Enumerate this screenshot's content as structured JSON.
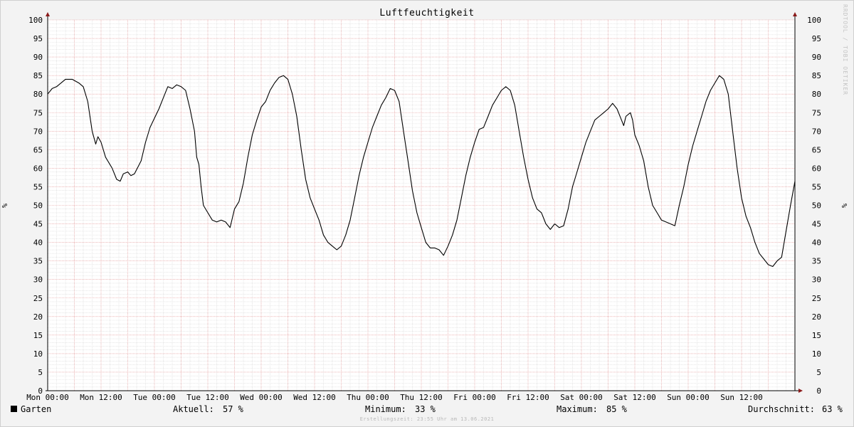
{
  "chart_data": {
    "type": "line",
    "title": "Luftfeuchtigkeit",
    "ylabel": "%",
    "ylabel_right": "%",
    "ylim": [
      0,
      100
    ],
    "yticks": [
      0,
      5,
      10,
      15,
      20,
      25,
      30,
      35,
      40,
      45,
      50,
      55,
      60,
      65,
      70,
      75,
      80,
      85,
      90,
      95,
      100
    ],
    "xlim_hours": [
      0,
      168
    ],
    "xticks": [
      {
        "h": 0,
        "label": "Mon 00:00"
      },
      {
        "h": 12,
        "label": "Mon 12:00"
      },
      {
        "h": 24,
        "label": "Tue 00:00"
      },
      {
        "h": 36,
        "label": "Tue 12:00"
      },
      {
        "h": 48,
        "label": "Wed 00:00"
      },
      {
        "h": 60,
        "label": "Wed 12:00"
      },
      {
        "h": 72,
        "label": "Thu 00:00"
      },
      {
        "h": 84,
        "label": "Thu 12:00"
      },
      {
        "h": 96,
        "label": "Fri 00:00"
      },
      {
        "h": 108,
        "label": "Fri 12:00"
      },
      {
        "h": 120,
        "label": "Sat 00:00"
      },
      {
        "h": 132,
        "label": "Sat 12:00"
      },
      {
        "h": 144,
        "label": "Sun 00:00"
      },
      {
        "h": 156,
        "label": "Sun 12:00"
      }
    ],
    "grid": true,
    "series": [
      {
        "name": "Garten",
        "color": "#000000",
        "points": [
          [
            0,
            80
          ],
          [
            1,
            81.5
          ],
          [
            2,
            82
          ],
          [
            3,
            83
          ],
          [
            4,
            84
          ],
          [
            5.5,
            84
          ],
          [
            7,
            83
          ],
          [
            8,
            82
          ],
          [
            9,
            78
          ],
          [
            10,
            70
          ],
          [
            10.8,
            66.5
          ],
          [
            11.3,
            68.5
          ],
          [
            12,
            67
          ],
          [
            13,
            63
          ],
          [
            14.5,
            60
          ],
          [
            15.5,
            57
          ],
          [
            16.3,
            56.5
          ],
          [
            17,
            58.5
          ],
          [
            18,
            59
          ],
          [
            18.7,
            58
          ],
          [
            19.5,
            58.5
          ],
          [
            21,
            62
          ],
          [
            22,
            67
          ],
          [
            23,
            71
          ],
          [
            24,
            73.5
          ],
          [
            25,
            76
          ],
          [
            26,
            79
          ],
          [
            27,
            82
          ],
          [
            28,
            81.5
          ],
          [
            29,
            82.5
          ],
          [
            30,
            82
          ],
          [
            31,
            81
          ],
          [
            32,
            76
          ],
          [
            33,
            70
          ],
          [
            33.5,
            63
          ],
          [
            34,
            61
          ],
          [
            34.5,
            55
          ],
          [
            35,
            50
          ],
          [
            36,
            48
          ],
          [
            37,
            46
          ],
          [
            38,
            45.5
          ],
          [
            39,
            46
          ],
          [
            40,
            45.5
          ],
          [
            41,
            44
          ],
          [
            42,
            49
          ],
          [
            43,
            51
          ],
          [
            44,
            56
          ],
          [
            45,
            63
          ],
          [
            46,
            69
          ],
          [
            47,
            73
          ],
          [
            48,
            76.5
          ],
          [
            49,
            78
          ],
          [
            50,
            81
          ],
          [
            51,
            83
          ],
          [
            52,
            84.5
          ],
          [
            53,
            85
          ],
          [
            54,
            84
          ],
          [
            55,
            80
          ],
          [
            56,
            74
          ],
          [
            57,
            65
          ],
          [
            58,
            57
          ],
          [
            59,
            52
          ],
          [
            60,
            49
          ],
          [
            61,
            46
          ],
          [
            62,
            42
          ],
          [
            63,
            40
          ],
          [
            64,
            39
          ],
          [
            65,
            38
          ],
          [
            66,
            39
          ],
          [
            67,
            42
          ],
          [
            68,
            46
          ],
          [
            69,
            52
          ],
          [
            70,
            58
          ],
          [
            71,
            63
          ],
          [
            72,
            67
          ],
          [
            73,
            71
          ],
          [
            74,
            74
          ],
          [
            75,
            77
          ],
          [
            76,
            79
          ],
          [
            77,
            81.5
          ],
          [
            78,
            81
          ],
          [
            79,
            78
          ],
          [
            80,
            70
          ],
          [
            81,
            62
          ],
          [
            82,
            54
          ],
          [
            83,
            48
          ],
          [
            84,
            44
          ],
          [
            85,
            40
          ],
          [
            86,
            38.5
          ],
          [
            87,
            38.5
          ],
          [
            88,
            38
          ],
          [
            89,
            36.5
          ],
          [
            90,
            39
          ],
          [
            91,
            42
          ],
          [
            92,
            46
          ],
          [
            93,
            52
          ],
          [
            94,
            58
          ],
          [
            95,
            63
          ],
          [
            96,
            67
          ],
          [
            97,
            70.5
          ],
          [
            98,
            71
          ],
          [
            99,
            74
          ],
          [
            100,
            77
          ],
          [
            101,
            79
          ],
          [
            102,
            81
          ],
          [
            103,
            82
          ],
          [
            104,
            81
          ],
          [
            105,
            77
          ],
          [
            106,
            70
          ],
          [
            107,
            63
          ],
          [
            108,
            57
          ],
          [
            109,
            52
          ],
          [
            110,
            49
          ],
          [
            111,
            48
          ],
          [
            112,
            45
          ],
          [
            113,
            43.5
          ],
          [
            114,
            45
          ],
          [
            115,
            44
          ],
          [
            116,
            44.5
          ],
          [
            117,
            49
          ],
          [
            118,
            55
          ],
          [
            119,
            59
          ],
          [
            120,
            63
          ],
          [
            121,
            67
          ],
          [
            122,
            70
          ],
          [
            123,
            73
          ],
          [
            124,
            74
          ],
          [
            125,
            75
          ],
          [
            126,
            76
          ],
          [
            127,
            77.5
          ],
          [
            128,
            76
          ],
          [
            129,
            73
          ],
          [
            129.5,
            71.5
          ],
          [
            130,
            74
          ],
          [
            131,
            75
          ],
          [
            131.5,
            73
          ],
          [
            132,
            69
          ],
          [
            133,
            66
          ],
          [
            134,
            62
          ],
          [
            135,
            55
          ],
          [
            136,
            50
          ],
          [
            137,
            48
          ],
          [
            138,
            46
          ],
          [
            139,
            45.5
          ],
          [
            140,
            45
          ],
          [
            141,
            44.5
          ],
          [
            142,
            50
          ],
          [
            143,
            55
          ],
          [
            144,
            61
          ],
          [
            145,
            66
          ],
          [
            146,
            70
          ],
          [
            147,
            74
          ],
          [
            148,
            78
          ],
          [
            149,
            81
          ],
          [
            150,
            83
          ],
          [
            151,
            85
          ],
          [
            152,
            84
          ],
          [
            153,
            80
          ],
          [
            154,
            70
          ],
          [
            155,
            60
          ],
          [
            156,
            52
          ],
          [
            157,
            47
          ],
          [
            158,
            44
          ],
          [
            159,
            40
          ],
          [
            160,
            37
          ],
          [
            161,
            35.5
          ],
          [
            162,
            34
          ],
          [
            163,
            33.5
          ],
          [
            164,
            35
          ],
          [
            165,
            36
          ],
          [
            166,
            43
          ],
          [
            167,
            50
          ],
          [
            168,
            56.5
          ]
        ]
      }
    ]
  },
  "legend": {
    "series_name": "Garten",
    "current_label": "Aktuell:",
    "current_value": "57 %",
    "min_label": "Minimum:",
    "min_value": "33 %",
    "max_label": "Maximum:",
    "max_value": "85 %",
    "avg_label": "Durchschnitt:",
    "avg_value": "63 %"
  },
  "watermark": "RRDTOOL / TOBI OETIKER",
  "footer": "Erstellungszeit: 23:55 Uhr am 13.06.2021"
}
